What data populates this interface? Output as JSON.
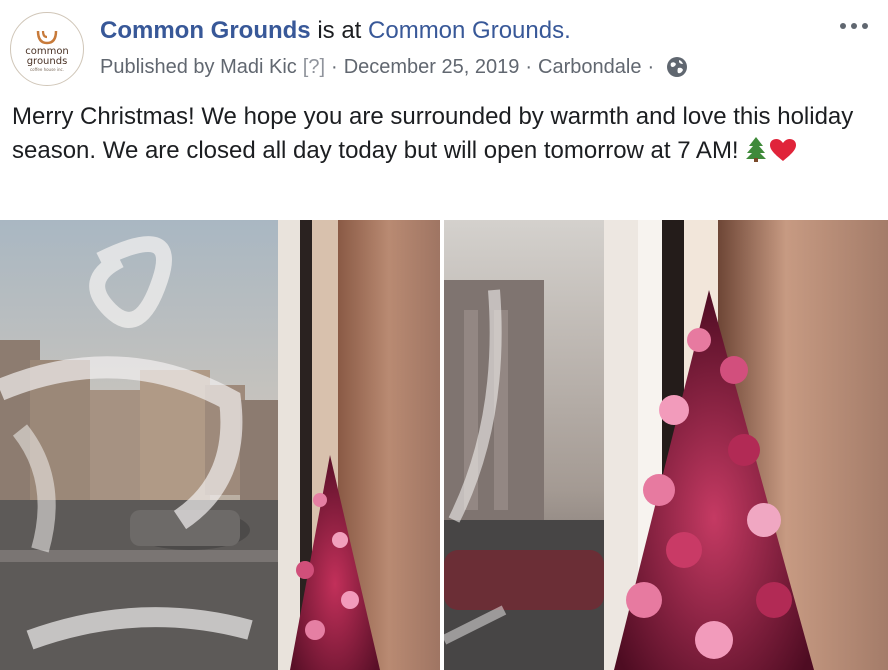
{
  "post": {
    "page_name": "Common Grounds",
    "is_at": "is at",
    "location_name": "Common Grounds.",
    "published_by": "Published by Madi Kic",
    "help_mark": "[?]",
    "separator": "·",
    "date": "December 25, 2019",
    "city": "Carbondale",
    "privacy_icon": "globe-icon",
    "more_icon": "more-dots-icon",
    "message": "Merry Christmas! We hope you are surrounded by warmth and love this holiday season. We are closed all day today but will open tomorrow at 7 AM!",
    "emojis": [
      "christmas-tree-icon",
      "red-heart-icon"
    ]
  },
  "avatar": {
    "line1": "common",
    "line2": "grounds",
    "line3": "coffee house inc."
  },
  "colors": {
    "link": "#385898",
    "meta": "#616770",
    "text": "#1c1e21"
  },
  "photos": [
    {
      "name": "window-tree-photo-left"
    },
    {
      "name": "window-tree-photo-right"
    }
  ]
}
